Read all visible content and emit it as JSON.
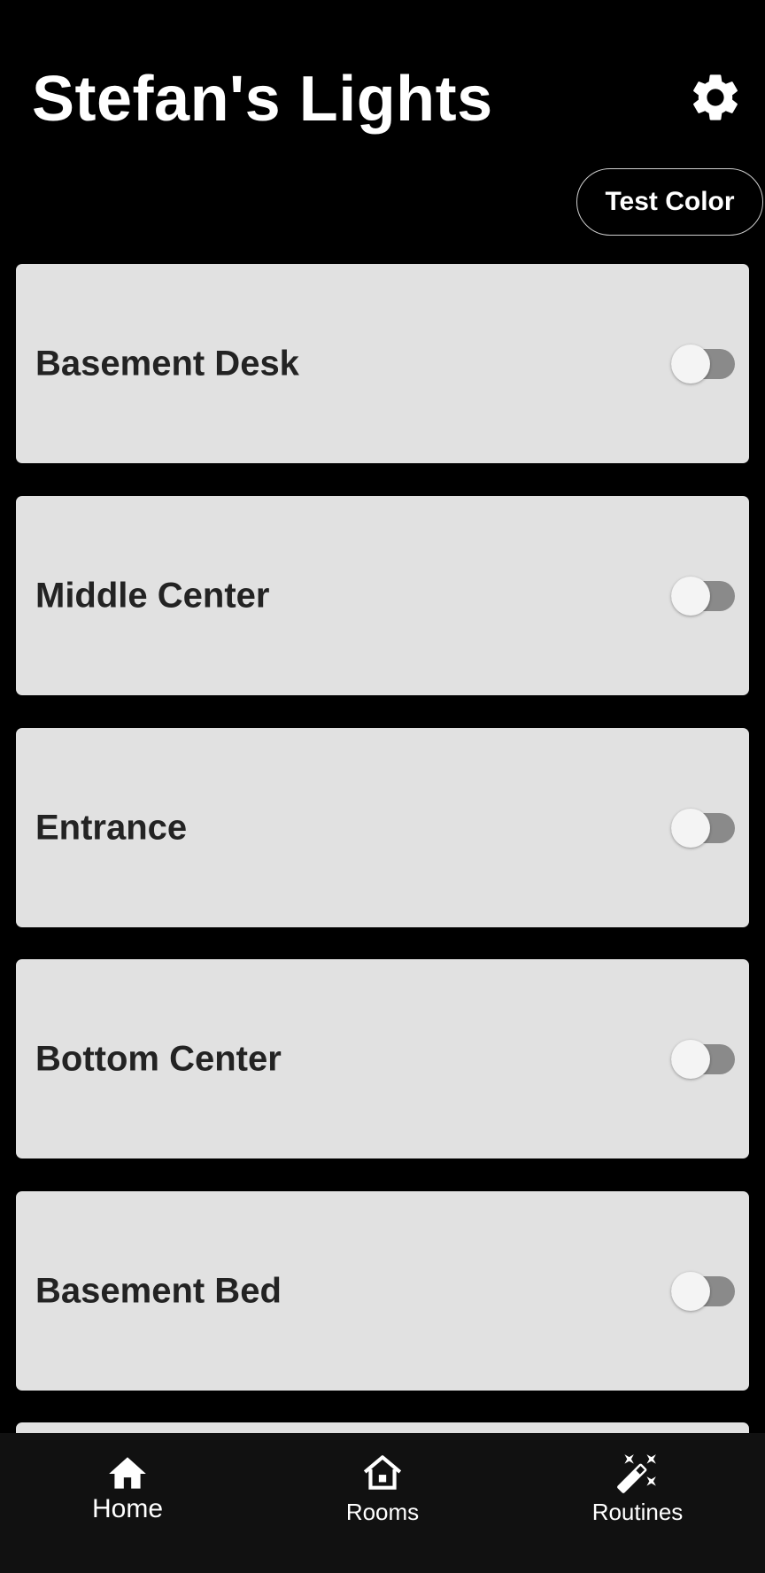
{
  "header": {
    "title": "Stefan's Lights",
    "settings_icon": "gear-icon",
    "test_color_label": "Test Color"
  },
  "lights": [
    {
      "name": "Basement Desk",
      "on": false
    },
    {
      "name": "Middle Center",
      "on": false
    },
    {
      "name": "Entrance",
      "on": false
    },
    {
      "name": "Bottom Center",
      "on": false
    },
    {
      "name": "Basement Bed",
      "on": false
    }
  ],
  "bottom_nav": {
    "items": [
      {
        "label": "Home",
        "icon": "home-icon",
        "selected": true
      },
      {
        "label": "Rooms",
        "icon": "rooms-icon",
        "selected": false
      },
      {
        "label": "Routines",
        "icon": "magic-wand-icon",
        "selected": false
      }
    ]
  },
  "colors": {
    "background": "#000000",
    "card": "#e1e1e1",
    "card_text": "#232323",
    "toggle_track_off": "#8a8a8a",
    "toggle_thumb": "#f4f4f4",
    "nav_background": "#111111",
    "text_primary": "#ffffff"
  }
}
